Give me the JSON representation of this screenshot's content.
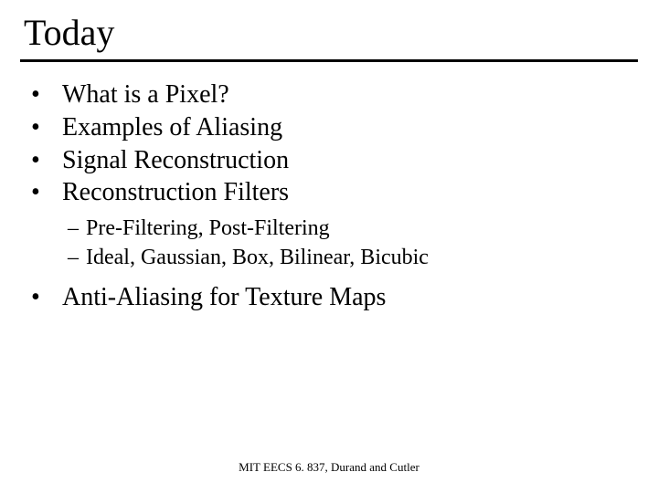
{
  "title": "Today",
  "bullets": {
    "b0": "What is a Pixel?",
    "b1": "Examples of Aliasing",
    "b2": "Signal Reconstruction",
    "b3": "Reconstruction Filters",
    "b4": "Anti-Aliasing for Texture Maps"
  },
  "sub": {
    "s0": "Pre-Filtering, Post-Filtering",
    "s1": "Ideal, Gaussian, Box, Bilinear, Bicubic"
  },
  "footer": "MIT EECS 6. 837, Durand and Cutler"
}
